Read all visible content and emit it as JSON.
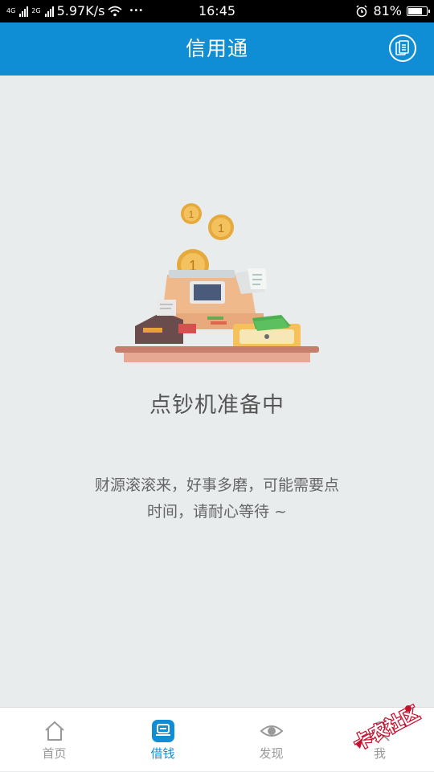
{
  "status_bar": {
    "network_4g": "4G",
    "network_2g": "2G",
    "speed": "5.97K/s",
    "dots": "•••",
    "time": "16:45",
    "battery": "81%",
    "battery_level": 0.81
  },
  "app_bar": {
    "title": "信用通",
    "doc_icon": "document-icon"
  },
  "main": {
    "heading": "点钞机准备中",
    "message_line1": "财源滚滚来，好事多磨，可能需要点",
    "message_line2": "时间，请耐心等待 ~",
    "coin_label": "1"
  },
  "tabs": [
    {
      "label": "首页",
      "icon": "home-icon",
      "active": false
    },
    {
      "label": "借钱",
      "icon": "borrow-money-icon",
      "active": true
    },
    {
      "label": "发现",
      "icon": "eye-icon",
      "active": false
    },
    {
      "label": "我",
      "icon": "user-icon",
      "active": false
    }
  ],
  "watermark": {
    "text": "卡农社区"
  },
  "colors": {
    "primary": "#0f8ed6",
    "background": "#e9eced",
    "inactive_tab": "#999999"
  }
}
